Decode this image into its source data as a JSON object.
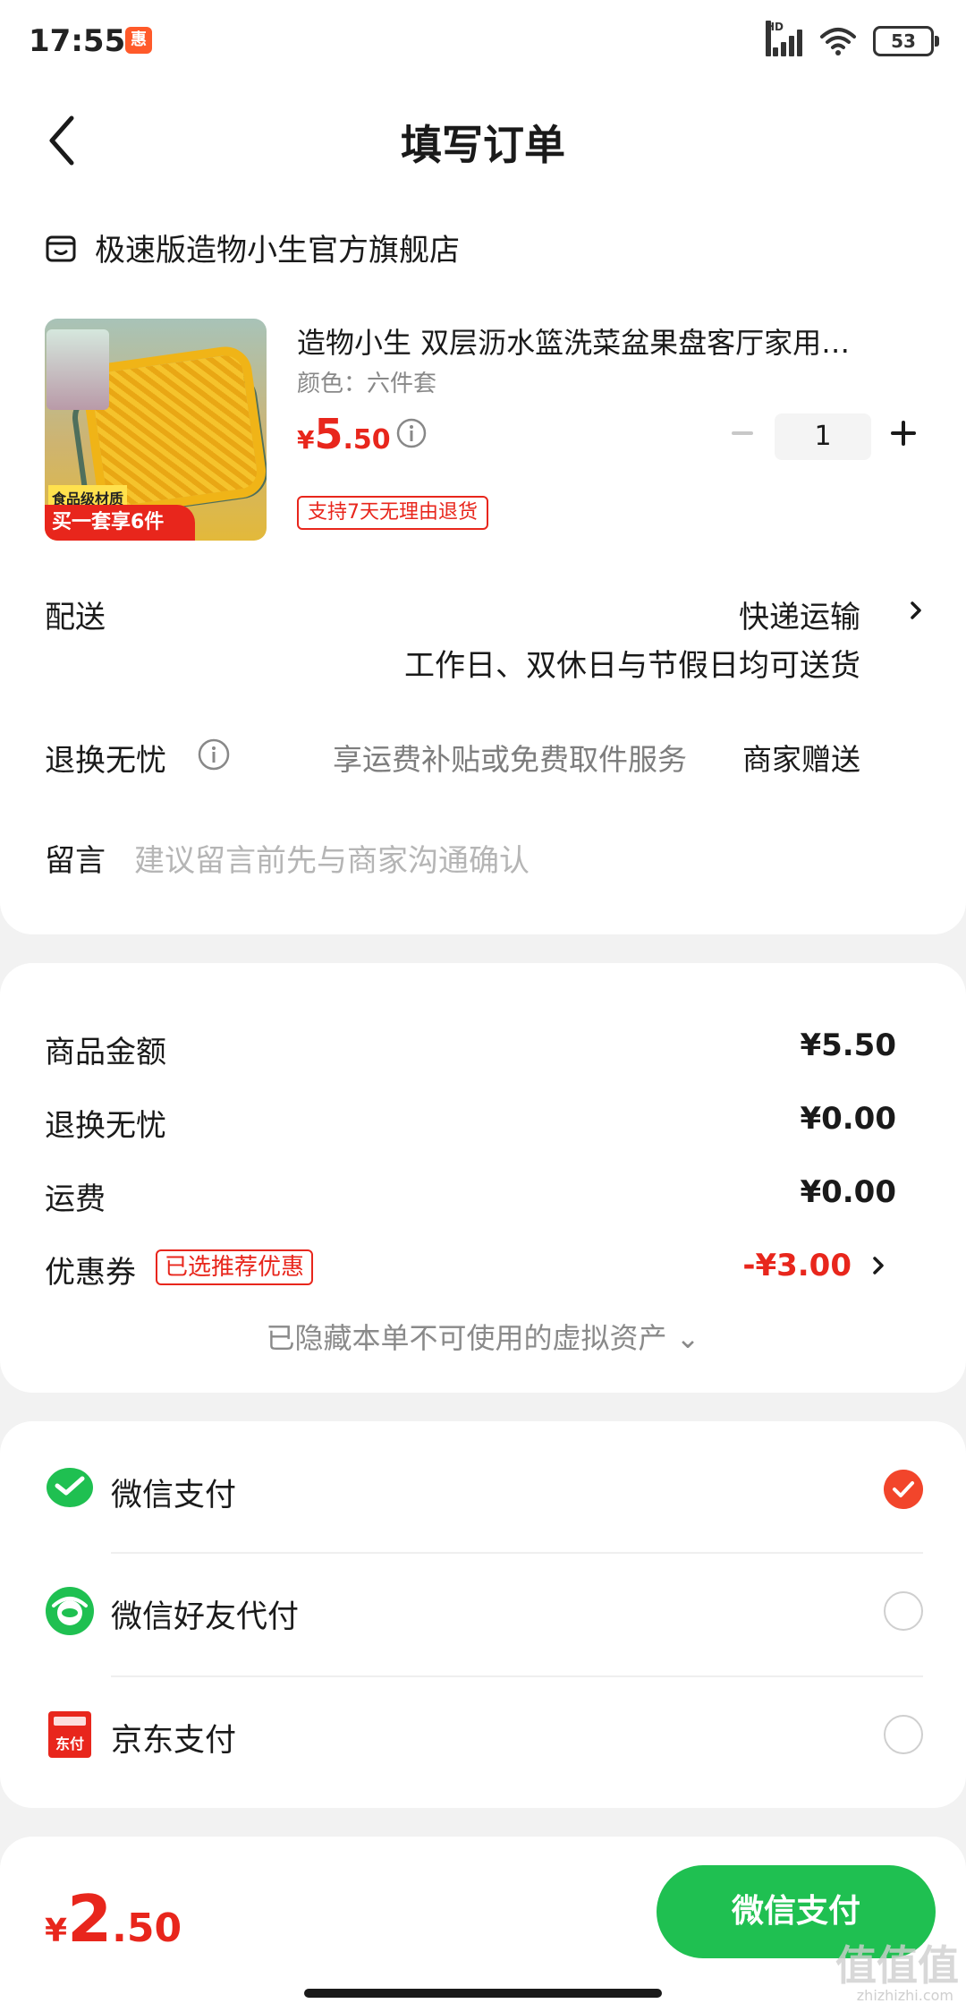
{
  "status_bar": {
    "time": "17:55",
    "app_icon_label": "惠",
    "network_label": "HD",
    "battery": "53"
  },
  "nav": {
    "title": "填写订单"
  },
  "store": {
    "name": "极速版造物小生官方旗舰店"
  },
  "product": {
    "title": "造物小生 双层沥水篮洗菜盆果盘客厅家用…",
    "spec": "颜色：六件套",
    "price_currency": "¥",
    "price_int": "5",
    "price_dec": ".50",
    "quantity": "1",
    "image_badge_food": "食品级材质",
    "image_badge_set": "买一套享6件",
    "return_tag": "支持7天无理由退货"
  },
  "delivery": {
    "label": "配送",
    "method": "快递运输",
    "note": "工作日、双休日与节假日均可送货"
  },
  "return_service": {
    "label": "退换无忧",
    "description": "享运费补贴或免费取件服务",
    "gift": "商家赠送"
  },
  "message": {
    "label": "留言",
    "placeholder": "建议留言前先与商家沟通确认"
  },
  "amounts": {
    "goods_label": "商品金额",
    "goods_value": "¥5.50",
    "return_label": "退换无忧",
    "return_value": "¥0.00",
    "shipping_label": "运费",
    "shipping_value": "¥0.00",
    "coupon_label": "优惠券",
    "coupon_tag": "已选推荐优惠",
    "coupon_value": "-¥3.00",
    "hidden_assets": "已隐藏本单不可使用的虚拟资产 ⌄"
  },
  "payment": {
    "options": [
      {
        "label": "微信支付",
        "selected": true
      },
      {
        "label": "微信好友代付",
        "selected": false
      },
      {
        "label": "京东支付",
        "selected": false
      }
    ],
    "jd_icon_text": "东付"
  },
  "footer": {
    "total_currency": "¥",
    "total_int": "2",
    "total_dec": ".50",
    "pay_button": "微信支付",
    "watermark": "值值值",
    "watermark_sub": "zhizhizhi.com"
  },
  "colors": {
    "accent_red": "#e8261c",
    "wechat_green": "#1fc051",
    "radio_checked": "#f2452b"
  }
}
